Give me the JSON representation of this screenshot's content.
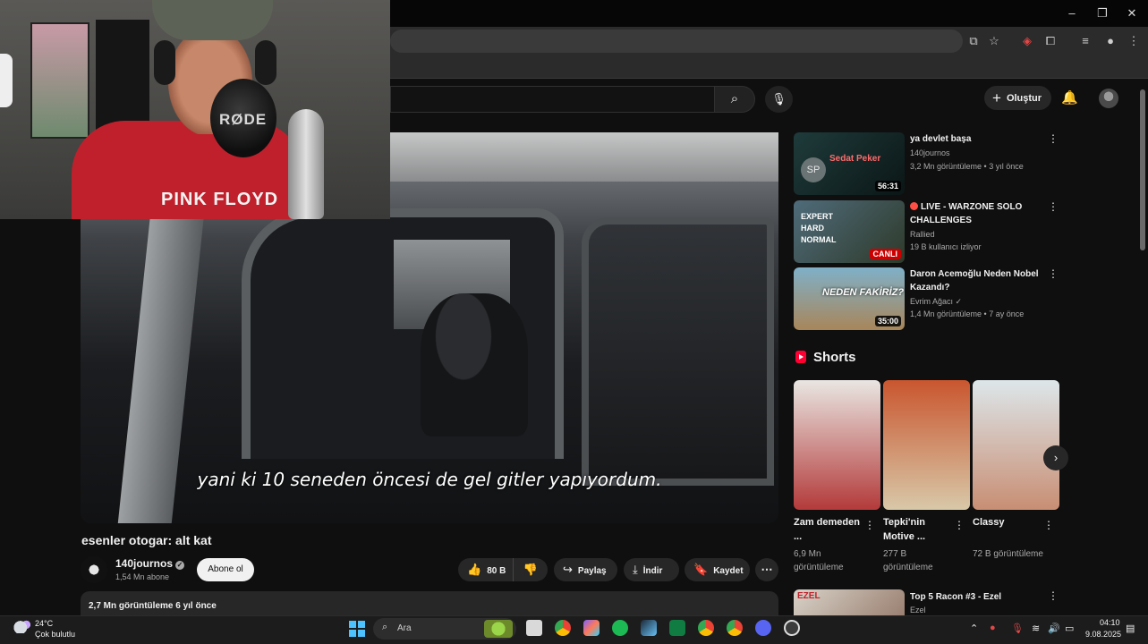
{
  "youtube": {
    "create_label": "Oluştur",
    "video": {
      "subtitle": "yani ki 10 seneden öncesi de gel gitler yapıyordum.",
      "title": "esenler otogar: alt kat",
      "channel": "140journos",
      "subscribers": "1,54 Mn abone",
      "subscribe_label": "Abone ol",
      "likes": "80 B",
      "share_label": "Paylaş",
      "download_label": "İndir",
      "save_label": "Kaydet",
      "stats": "2,7 Mn görüntüleme  6 yıl önce"
    },
    "recommendations": [
      {
        "title": "ya devlet başa",
        "channel": "140journos",
        "meta": "3,2 Mn görüntüleme • 3 yıl önce",
        "duration": "56:31",
        "thumb_text": "Sedat Peker"
      },
      {
        "title": "LIVE - WARZONE SOLO CHALLENGES",
        "channel": "Rallied",
        "meta": "19 B kullanıcı izliyor",
        "live_badge": "CANLI",
        "thumb_text": "EXPERT HARD NORMAL"
      },
      {
        "title": "Daron Acemoğlu Neden Nobel Kazandı?",
        "channel": "Evrim Ağacı",
        "meta": "1,4 Mn görüntüleme • 7 ay önce",
        "duration": "35:00",
        "thumb_text": "NEDEN FAKİRİZ?"
      }
    ],
    "shorts_heading": "Shorts",
    "shorts": [
      {
        "title": "Zam demeden ...",
        "views": "6,9 Mn görüntüleme"
      },
      {
        "title": "Tepki'nin Motive ...",
        "views": "277 B görüntüleme"
      },
      {
        "title": "Classy",
        "views": "72 B görüntüleme"
      }
    ],
    "next_rec": {
      "title": "Top 5 Racon #3 - Ezel",
      "channel": "Ezel",
      "thumb_text": "EZEL"
    }
  },
  "webcam": {
    "shirt_text": "PINK FLOYD",
    "mic_text": "RØDE"
  },
  "taskbar": {
    "temperature": "24°C",
    "weather": "Çok bulutlu",
    "search_placeholder": "Ara",
    "time": "04:10",
    "date": "9.08.2025"
  }
}
